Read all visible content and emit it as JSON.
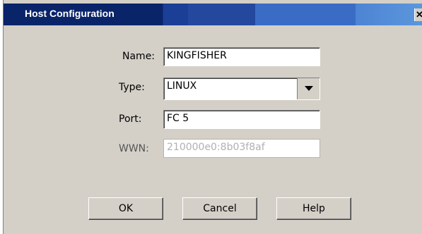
{
  "window": {
    "title": "Host Configuration",
    "close_glyph": "✕"
  },
  "form": {
    "name": {
      "label": "Name:",
      "value": "KINGFISHER"
    },
    "type": {
      "label": "Type:",
      "value": "LINUX"
    },
    "port": {
      "label": "Port:",
      "value": "FC 5"
    },
    "wwn": {
      "label": "WWN:",
      "value": "210000e0:8b03f8af"
    }
  },
  "buttons": {
    "ok": "OK",
    "cancel": "Cancel",
    "help": "Help"
  }
}
